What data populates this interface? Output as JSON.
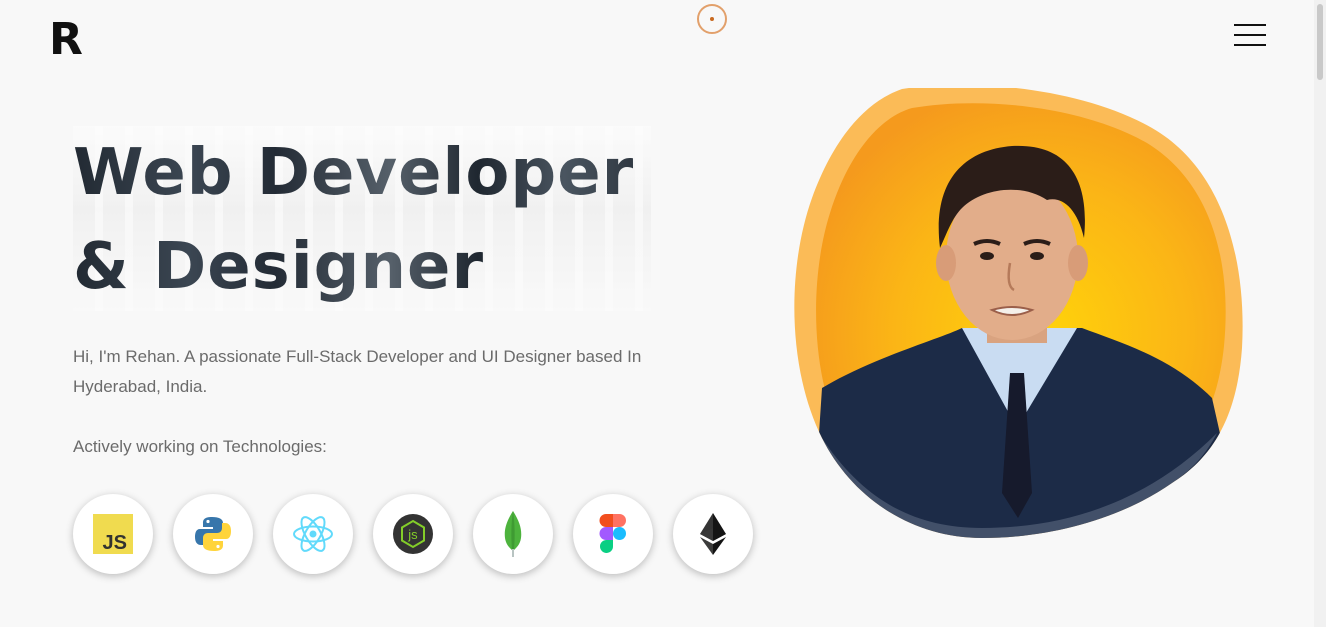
{
  "logo": {
    "text": "R"
  },
  "hero": {
    "headline_line1": "Web Developer",
    "headline_line2": "& Designer",
    "intro": "Hi, I'm Rehan. A passionate Full-Stack Developer and UI Designer based In Hyderabad, India.",
    "tech_heading": "Actively working on Technologies:"
  },
  "technologies": [
    {
      "name": "JavaScript",
      "icon": "javascript-icon",
      "label": "JS",
      "color": "#f0db4f"
    },
    {
      "name": "Python",
      "icon": "python-icon",
      "color": "#3776ab"
    },
    {
      "name": "React",
      "icon": "react-icon",
      "color": "#61dafb"
    },
    {
      "name": "Node.js",
      "icon": "nodejs-icon",
      "label": "js",
      "color": "#83cd29"
    },
    {
      "name": "MongoDB",
      "icon": "mongodb-icon",
      "color": "#4db33d"
    },
    {
      "name": "Figma",
      "icon": "figma-icon",
      "color": "#f24e1e"
    },
    {
      "name": "Ethereum",
      "icon": "ethereum-icon",
      "color": "#3c3c3d"
    }
  ],
  "colors": {
    "background": "#f8f8f8",
    "accent_orange": "#f9a825",
    "text_dark": "#111111",
    "text_muted": "#6b6b6b"
  }
}
